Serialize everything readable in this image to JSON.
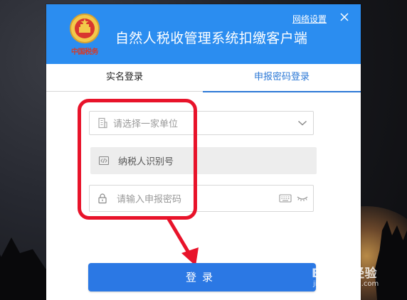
{
  "window": {
    "title": "自然人税收管理系统扣缴客户端",
    "emblem_text": "中国税务",
    "network_settings_label": "网络设置",
    "close_label": "×"
  },
  "tabs": [
    {
      "label": "实名登录",
      "active": false
    },
    {
      "label": "申报密码登录",
      "active": true
    }
  ],
  "form": {
    "unit_placeholder": "请选择一家单位",
    "taxid_placeholder": "纳税人识别号",
    "password_placeholder": "请输入申报密码"
  },
  "login_button_label": "登录",
  "watermark": {
    "main": "Baidu经验",
    "sub": "jingyan.baidu.com"
  },
  "colors": {
    "header_blue": "#2b8df0",
    "tab_active": "#2b78d6",
    "button_blue": "#2b78e4",
    "annotation_red": "#e8132a"
  },
  "icons": {
    "close": "close-icon",
    "building": "building-icon",
    "code": "code-icon",
    "lock": "lock-icon",
    "keyboard": "keyboard-icon",
    "eye_closed": "eye-closed-icon",
    "chevron": "chevron-down-icon"
  }
}
